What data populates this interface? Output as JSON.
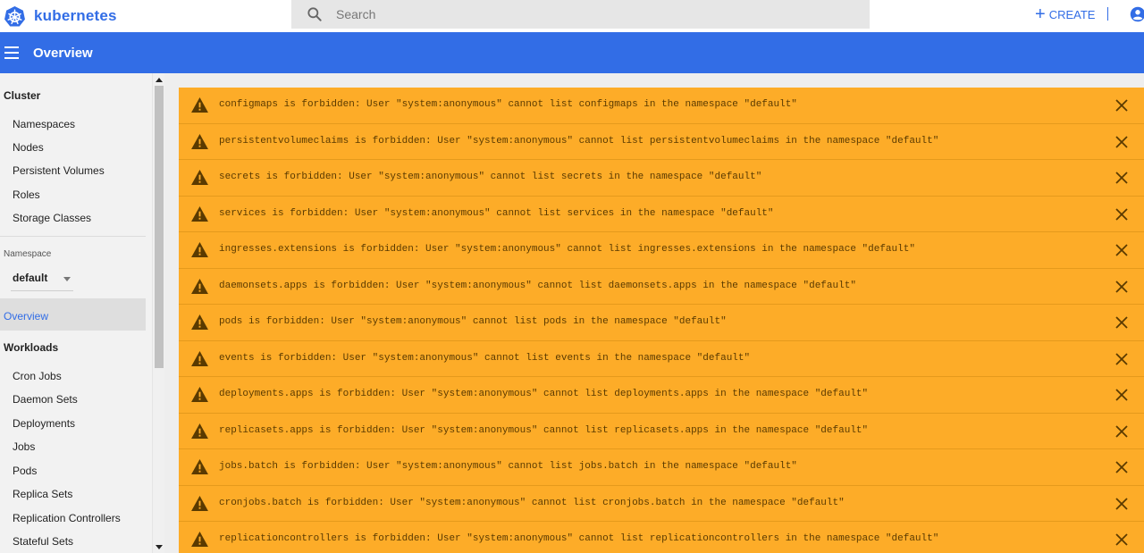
{
  "app": {
    "name": "kubernetes"
  },
  "search": {
    "placeholder": "Search"
  },
  "toolbar": {
    "create_label": "CREATE"
  },
  "header": {
    "title": "Overview"
  },
  "sidebar": {
    "cluster_heading": "Cluster",
    "cluster_items": [
      "Namespaces",
      "Nodes",
      "Persistent Volumes",
      "Roles",
      "Storage Classes"
    ],
    "namespace_label": "Namespace",
    "namespace_value": "default",
    "overview_label": "Overview",
    "workloads_heading": "Workloads",
    "workloads_items": [
      "Cron Jobs",
      "Daemon Sets",
      "Deployments",
      "Jobs",
      "Pods",
      "Replica Sets",
      "Replication Controllers",
      "Stateful Sets"
    ]
  },
  "alerts": [
    "configmaps is forbidden: User \"system:anonymous\" cannot list configmaps in the namespace \"default\"",
    "persistentvolumeclaims is forbidden: User \"system:anonymous\" cannot list persistentvolumeclaims in the namespace \"default\"",
    "secrets is forbidden: User \"system:anonymous\" cannot list secrets in the namespace \"default\"",
    "services is forbidden: User \"system:anonymous\" cannot list services in the namespace \"default\"",
    "ingresses.extensions is forbidden: User \"system:anonymous\" cannot list ingresses.extensions in the namespace \"default\"",
    "daemonsets.apps is forbidden: User \"system:anonymous\" cannot list daemonsets.apps in the namespace \"default\"",
    "pods is forbidden: User \"system:anonymous\" cannot list pods in the namespace \"default\"",
    "events is forbidden: User \"system:anonymous\" cannot list events in the namespace \"default\"",
    "deployments.apps is forbidden: User \"system:anonymous\" cannot list deployments.apps in the namespace \"default\"",
    "replicasets.apps is forbidden: User \"system:anonymous\" cannot list replicasets.apps in the namespace \"default\"",
    "jobs.batch is forbidden: User \"system:anonymous\" cannot list jobs.batch in the namespace \"default\"",
    "cronjobs.batch is forbidden: User \"system:anonymous\" cannot list cronjobs.batch in the namespace \"default\"",
    "replicationcontrollers is forbidden: User \"system:anonymous\" cannot list replicationcontrollers in the namespace \"default\""
  ],
  "colors": {
    "brand": "#326de6",
    "warning": "#fdac28",
    "sidebar_bg": "#f2f2f2",
    "main_bg": "#eeeeee"
  },
  "icons": {
    "logo": "kubernetes-logo-icon",
    "search": "search-icon",
    "create": "plus-icon",
    "account": "account-icon",
    "menu": "menu-icon",
    "warning": "warning-icon",
    "close": "close-icon"
  }
}
